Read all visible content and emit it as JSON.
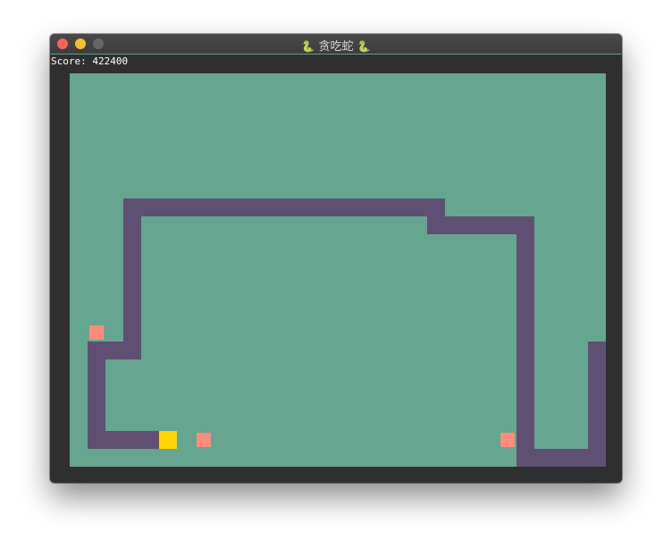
{
  "window": {
    "title": "贪吃蛇",
    "title_icon": "snake-icon",
    "buttons": [
      {
        "name": "close",
        "color": "#fe5f57"
      },
      {
        "name": "minimize",
        "color": "#febc2e"
      },
      {
        "name": "zoom",
        "color": "#666666"
      }
    ]
  },
  "score_label": "Score: 422400",
  "game": {
    "grid_cols": 30,
    "grid_rows": 22,
    "colors": {
      "board": "#66a690",
      "snake": "#5f5073",
      "head": "#ffd500",
      "food": "#fe8c7c"
    },
    "snake_head": [
      5,
      20
    ],
    "snake_segments": [
      [
        4,
        20
      ],
      [
        3,
        20
      ],
      [
        2,
        20
      ],
      [
        1,
        20
      ],
      [
        1,
        19
      ],
      [
        1,
        18
      ],
      [
        1,
        17
      ],
      [
        1,
        16
      ],
      [
        1,
        15
      ],
      [
        2,
        15
      ],
      [
        3,
        15
      ],
      [
        3,
        14
      ],
      [
        3,
        13
      ],
      [
        3,
        12
      ],
      [
        3,
        11
      ],
      [
        3,
        10
      ],
      [
        3,
        9
      ],
      [
        3,
        8
      ],
      [
        3,
        7
      ],
      [
        4,
        7
      ],
      [
        5,
        7
      ],
      [
        6,
        7
      ],
      [
        7,
        7
      ],
      [
        8,
        7
      ],
      [
        9,
        7
      ],
      [
        10,
        7
      ],
      [
        11,
        7
      ],
      [
        12,
        7
      ],
      [
        13,
        7
      ],
      [
        14,
        7
      ],
      [
        15,
        7
      ],
      [
        16,
        7
      ],
      [
        17,
        7
      ],
      [
        18,
        7
      ],
      [
        19,
        7
      ],
      [
        20,
        7
      ],
      [
        20,
        8
      ],
      [
        21,
        8
      ],
      [
        22,
        8
      ],
      [
        23,
        8
      ],
      [
        24,
        8
      ],
      [
        25,
        8
      ],
      [
        25,
        9
      ],
      [
        25,
        10
      ],
      [
        25,
        11
      ],
      [
        25,
        12
      ],
      [
        25,
        13
      ],
      [
        25,
        14
      ],
      [
        25,
        15
      ],
      [
        25,
        16
      ],
      [
        25,
        17
      ],
      [
        25,
        18
      ],
      [
        25,
        19
      ],
      [
        25,
        20
      ],
      [
        25,
        21
      ],
      [
        26,
        21
      ],
      [
        27,
        21
      ],
      [
        28,
        21
      ],
      [
        29,
        21
      ],
      [
        29,
        20
      ],
      [
        29,
        19
      ],
      [
        29,
        18
      ],
      [
        29,
        17
      ],
      [
        29,
        16
      ],
      [
        29,
        15
      ]
    ],
    "food": [
      [
        1,
        14
      ],
      [
        7,
        20
      ],
      [
        24,
        20
      ]
    ]
  }
}
